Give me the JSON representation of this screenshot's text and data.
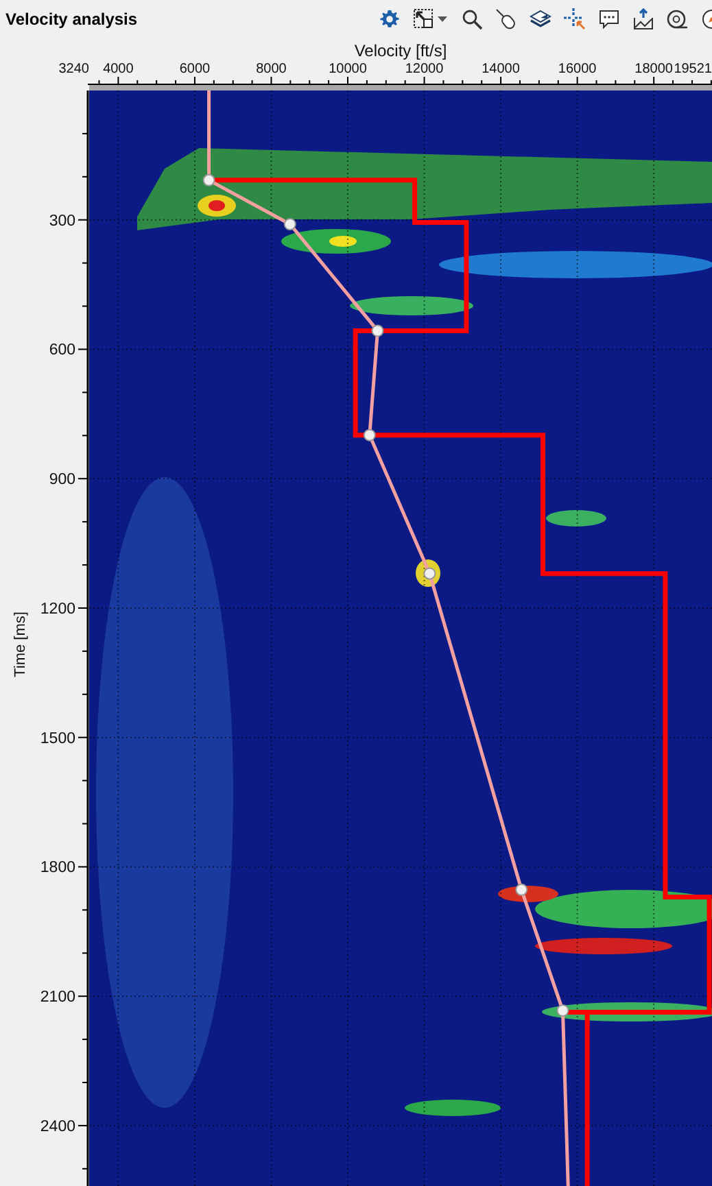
{
  "panel": {
    "title": "Velocity analysis"
  },
  "plot": {
    "x_axis": {
      "title": "Velocity [ft/s]",
      "ticks": [
        "3240",
        "4000",
        "6000",
        "8000",
        "10000",
        "12000",
        "14000",
        "16000",
        "18000",
        "19521"
      ]
    },
    "y_axis": {
      "title": "Time [ms]",
      "ticks": [
        "300",
        "600",
        "900",
        "1200",
        "1500",
        "1800",
        "2100",
        "2400"
      ]
    }
  }
}
